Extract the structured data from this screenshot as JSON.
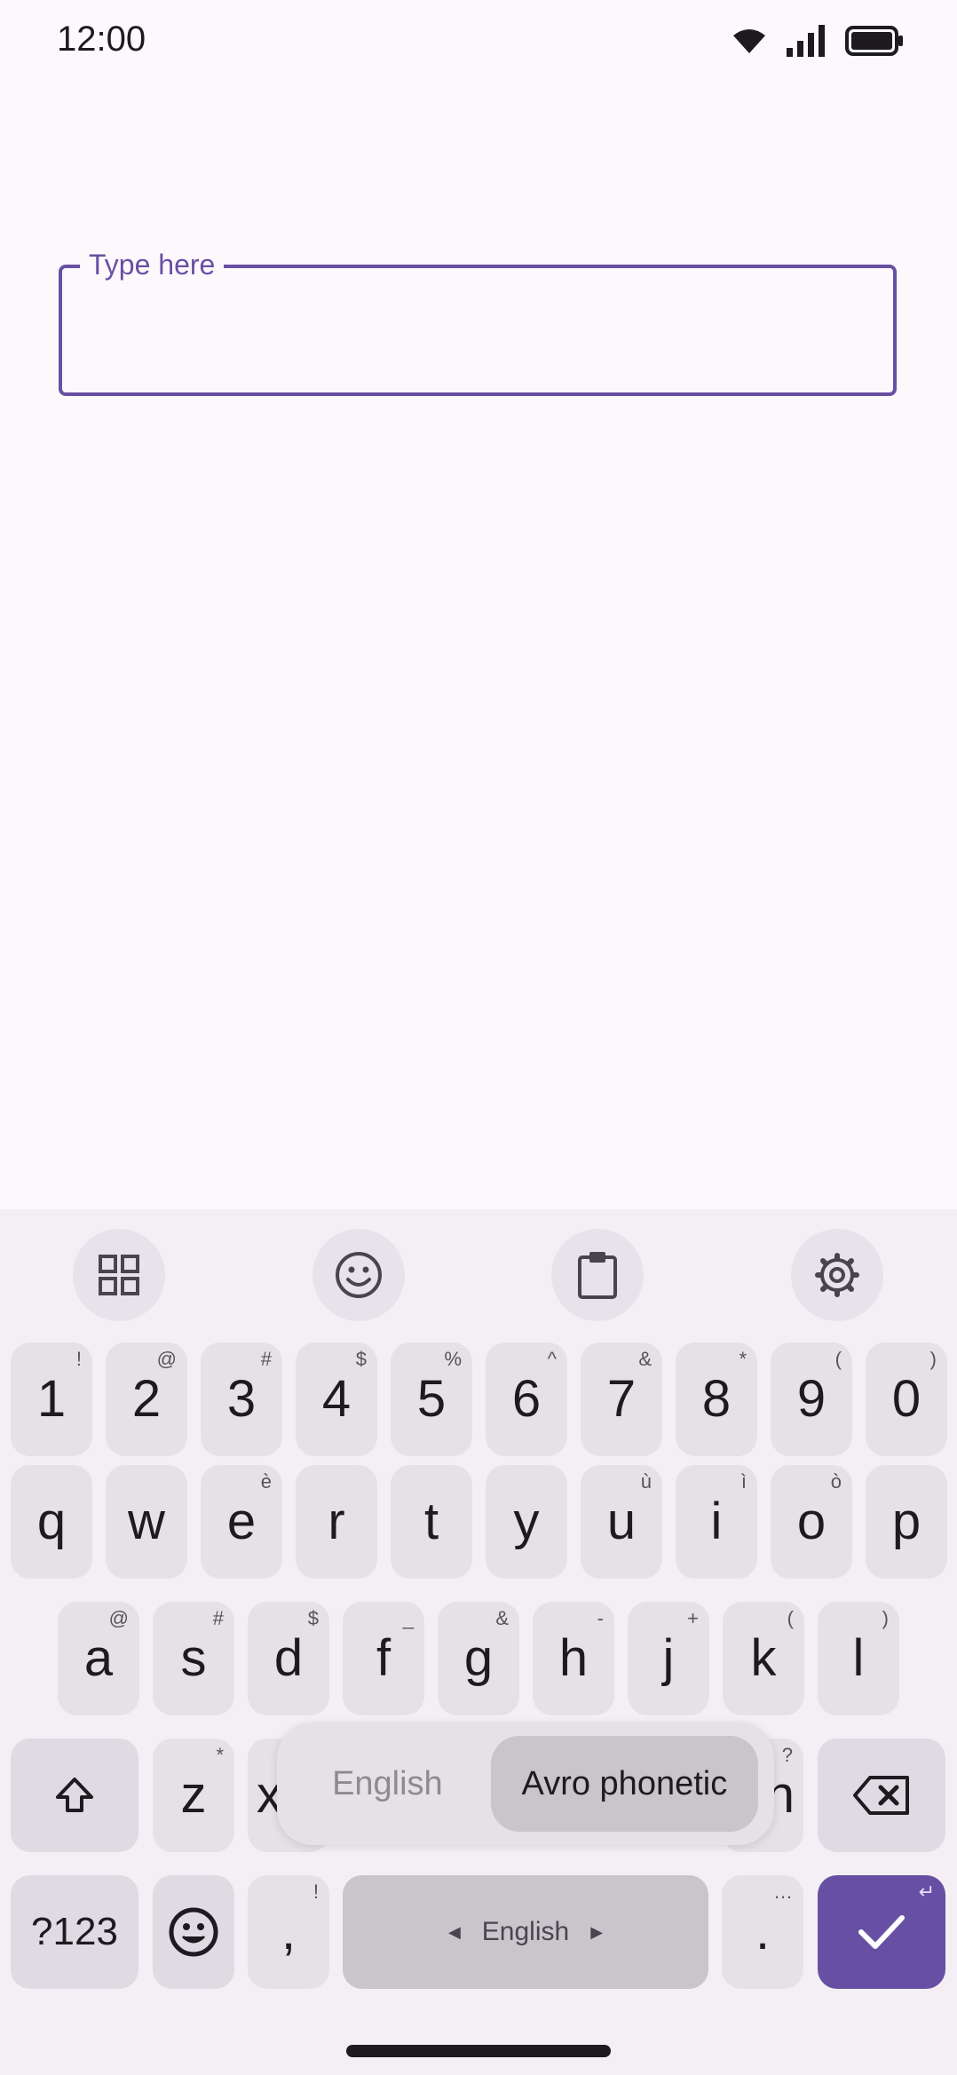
{
  "status_bar": {
    "time": "12:00",
    "icons": [
      "wifi-icon",
      "signal-icon",
      "battery-icon"
    ]
  },
  "text_field": {
    "label": "Type here",
    "value": ""
  },
  "keyboard": {
    "toolbar": [
      "apps-grid-icon",
      "emoji-icon",
      "clipboard-icon",
      "settings-gear-icon"
    ],
    "number_row": [
      {
        "key": "1",
        "hint": "!"
      },
      {
        "key": "2",
        "hint": "@"
      },
      {
        "key": "3",
        "hint": "#"
      },
      {
        "key": "4",
        "hint": "$"
      },
      {
        "key": "5",
        "hint": "%"
      },
      {
        "key": "6",
        "hint": "^"
      },
      {
        "key": "7",
        "hint": "&"
      },
      {
        "key": "8",
        "hint": "*"
      },
      {
        "key": "9",
        "hint": "("
      },
      {
        "key": "0",
        "hint": ")"
      }
    ],
    "row1": [
      {
        "key": "q",
        "hint": ""
      },
      {
        "key": "w",
        "hint": ""
      },
      {
        "key": "e",
        "hint": "è"
      },
      {
        "key": "r",
        "hint": ""
      },
      {
        "key": "t",
        "hint": ""
      },
      {
        "key": "y",
        "hint": ""
      },
      {
        "key": "u",
        "hint": "ù"
      },
      {
        "key": "i",
        "hint": "ì"
      },
      {
        "key": "o",
        "hint": "ò"
      },
      {
        "key": "p",
        "hint": ""
      }
    ],
    "row2": [
      {
        "key": "a",
        "hint": "@"
      },
      {
        "key": "s",
        "hint": "#"
      },
      {
        "key": "d",
        "hint": "$"
      },
      {
        "key": "f",
        "hint": "_"
      },
      {
        "key": "g",
        "hint": "&"
      },
      {
        "key": "h",
        "hint": "-"
      },
      {
        "key": "j",
        "hint": "+"
      },
      {
        "key": "k",
        "hint": "("
      },
      {
        "key": "l",
        "hint": ")"
      }
    ],
    "row3": {
      "z_key": "z",
      "z_hint": "*",
      "partial_left": "x",
      "partial_right": "n",
      "partial_right_hint": "?"
    },
    "bottom_row": {
      "symbols_label": "?123",
      "comma": ",",
      "comma_hint": "!",
      "space_label": "English",
      "period": ".",
      "period_hint": "…",
      "enter_hint": "↵"
    },
    "language_popup": {
      "options": [
        "English",
        "Avro phonetic"
      ],
      "selected": "Avro phonetic"
    }
  }
}
